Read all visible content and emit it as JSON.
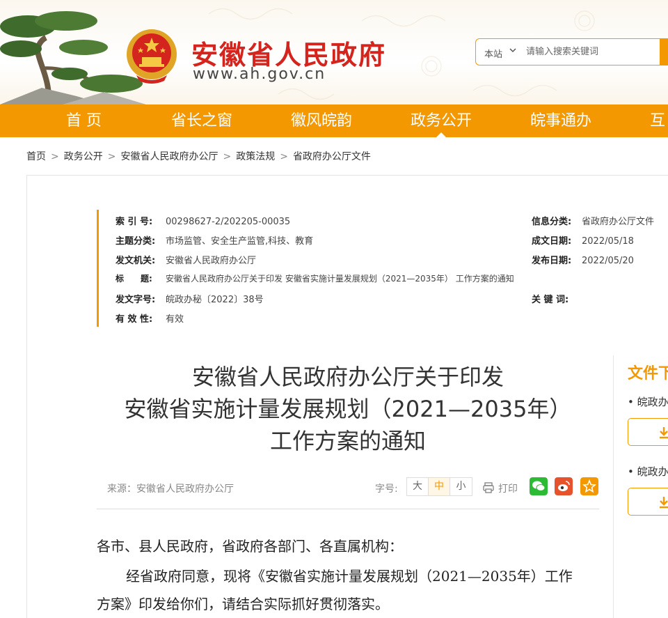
{
  "header": {
    "site_title": "安徽省人民政府",
    "site_url": "www.ah.gov.cn",
    "search_scope": "本站",
    "search_placeholder": "请输入搜索关键词"
  },
  "nav": {
    "items": [
      "首 页",
      "省长之窗",
      "徽风皖韵",
      "政务公开",
      "皖事通办",
      "互"
    ],
    "active": "政务公开"
  },
  "breadcrumb": [
    "首页",
    "政务公开",
    "安徽省人民政府办公厅",
    "政策法规",
    "省政府办公厅文件"
  ],
  "meta": {
    "index_label": "索 引 号:",
    "index_value": "00298627-2/202205-00035",
    "category_label": "信息分类:",
    "category_value": "省政府办公厅文件",
    "topic_label": "主题分类:",
    "topic_value": "市场监管、安全生产监管,科技、教育",
    "date_label": "成文日期:",
    "date_value": "2022/05/18",
    "issuer_label": "发文机关:",
    "issuer_value": "安徽省人民政府办公厅",
    "publish_label": "发布日期:",
    "publish_value": "2022/05/20",
    "title_label": "标　　题:",
    "title_value": "安徽省人民政府办公厅关于印发 安徽省实施计量发展规划（2021—2035年） 工作方案的通知",
    "docno_label": "发文字号:",
    "docno_value": "皖政办秘〔2022〕38号",
    "keywords_label": "关 键 词:",
    "validity_label": "有 效 性:",
    "validity_value": "有效"
  },
  "document": {
    "title_line1": "安徽省人民政府办公厅关于印发",
    "title_line2": "安徽省实施计量发展规划（2021—2035年）",
    "title_line3": "工作方案的通知",
    "source": "来源：安徽省人民政府办公厅",
    "font_size_label": "字号:",
    "font_sizes": [
      "大",
      "中",
      "小"
    ],
    "print_label": "打印",
    "salutation": "各市、县人民政府，省政府各部门、各直属机构：",
    "paragraph_line1": "经省政府同意，现将《安徽省实施计量发展规划（2021—2035年）工作",
    "paragraph_line2": "方案》印发给你们，请结合实际抓好贯彻落实。"
  },
  "sidebar": {
    "title": "文件下",
    "item1": "皖政办",
    "item2": "皖政办"
  },
  "colors": {
    "accent": "#f39800",
    "brand_red": "#d3241d",
    "wechat": "#2dbb35",
    "weibo": "#e6522c"
  }
}
